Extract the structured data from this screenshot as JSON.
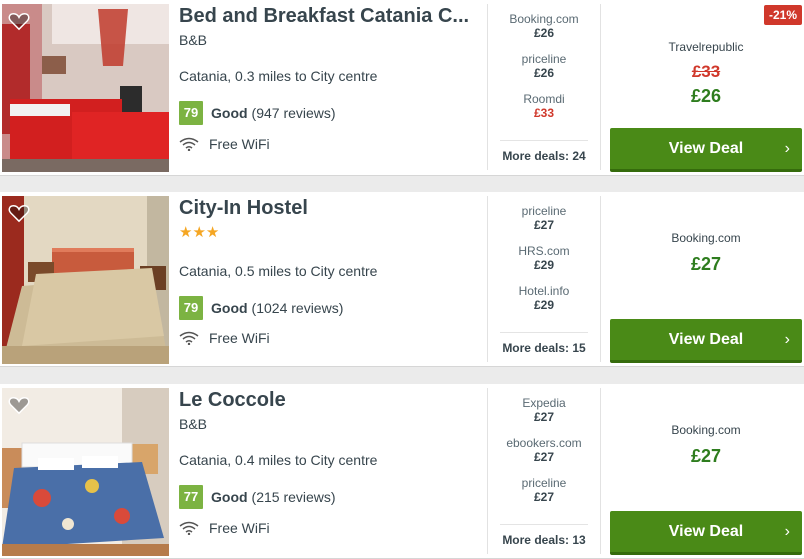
{
  "hotels": [
    {
      "name": "Bed and Breakfast Catania C...",
      "type": "B&B",
      "stars": "",
      "location": "Catania, 0.3 miles to City centre",
      "score": "79",
      "rating_label": "Good",
      "reviews": "(947 reviews)",
      "amenity": "Free WiFi",
      "other_deals": [
        {
          "provider": "Booking.com",
          "price": "£26"
        },
        {
          "provider": "priceline",
          "price": "£26"
        },
        {
          "provider": "Roomdi",
          "price": "£33"
        }
      ],
      "more_deals": "More deals: 24",
      "best_provider": "Travelrepublic",
      "old_price": "£33",
      "best_price": "£26",
      "discount": "-21%",
      "button": "View Deal"
    },
    {
      "name": "City-In Hostel",
      "type": "",
      "stars": "★★★",
      "location": "Catania, 0.5 miles to City centre",
      "score": "79",
      "rating_label": "Good",
      "reviews": "(1024 reviews)",
      "amenity": "Free WiFi",
      "other_deals": [
        {
          "provider": "priceline",
          "price": "£27"
        },
        {
          "provider": "HRS.com",
          "price": "£29"
        },
        {
          "provider": "Hotel.info",
          "price": "£29"
        }
      ],
      "more_deals": "More deals: 15",
      "best_provider": "Booking.com",
      "old_price": "",
      "best_price": "£27",
      "discount": "",
      "button": "View Deal"
    },
    {
      "name": "Le Coccole",
      "type": "B&B",
      "stars": "",
      "location": "Catania, 0.4 miles to City centre",
      "score": "77",
      "rating_label": "Good",
      "reviews": "(215 reviews)",
      "amenity": "Free WiFi",
      "other_deals": [
        {
          "provider": "Expedia",
          "price": "£27"
        },
        {
          "provider": "ebookers.com",
          "price": "£27"
        },
        {
          "provider": "priceline",
          "price": "£27"
        }
      ],
      "more_deals": "More deals: 13",
      "best_provider": "Booking.com",
      "old_price": "",
      "best_price": "£27",
      "discount": "",
      "button": "View Deal"
    }
  ],
  "colors": {
    "accent_green": "#4a8a17",
    "price_green": "#2e7d1e",
    "alert_red": "#d0382b",
    "score_green": "#7cb342",
    "star_gold": "#f5a623"
  },
  "icons": [
    "heart-icon",
    "wifi-icon",
    "chevron-right-icon"
  ]
}
